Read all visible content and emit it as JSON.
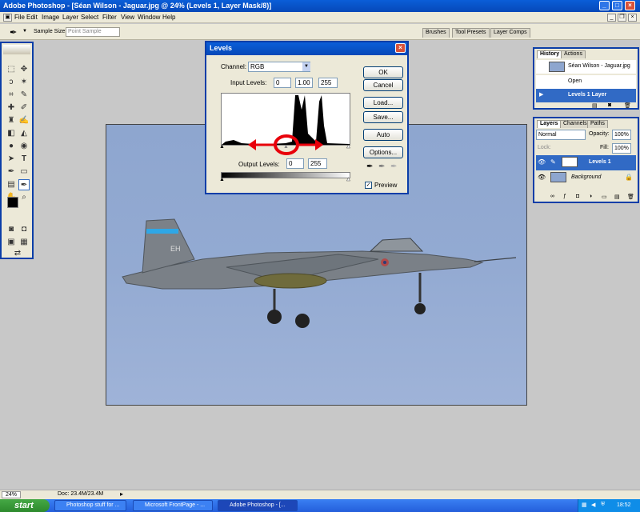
{
  "window": {
    "title": "Adobe Photoshop - [Séan Wilson - Jaguar.jpg @ 24% (Levels 1, Layer Mask/8)]",
    "minimize": "_",
    "maximize": "□",
    "close": "×"
  },
  "menu": [
    "File",
    "Edit",
    "Image",
    "Layer",
    "Select",
    "Filter",
    "View",
    "Window",
    "Help"
  ],
  "options_bar": {
    "sample_size_label": "Sample Size:",
    "sample_size_value": "Point Sample",
    "palette_well_tabs": [
      "Brushes",
      "Tool Presets",
      "Layer Comps"
    ]
  },
  "levels": {
    "title": "Levels",
    "channel_label": "Channel:",
    "channel_value": "RGB",
    "input_levels_label": "Input Levels:",
    "input_black": "0",
    "input_gamma": "1.00",
    "input_white": "255",
    "output_levels_label": "Output Levels:",
    "output_black": "0",
    "output_white": "255",
    "buttons": {
      "ok": "OK",
      "cancel": "Cancel",
      "load": "Load...",
      "save": "Save...",
      "auto": "Auto",
      "options": "Options..."
    },
    "preview_label": "Preview",
    "preview_checked": true
  },
  "history": {
    "tabs": [
      "History",
      "Actions"
    ],
    "snapshot": "Séan Wilson - Jaguar.jpg",
    "steps": [
      "Open",
      "Levels 1 Layer"
    ]
  },
  "layers": {
    "tabs": [
      "Layers",
      "Channels",
      "Paths"
    ],
    "blend_mode": "Normal",
    "opacity_label": "Opacity:",
    "opacity": "100%",
    "lock_label": "Lock:",
    "fill_label": "Fill:",
    "fill": "100%",
    "items": [
      {
        "name": "Levels 1"
      },
      {
        "name": "Background"
      }
    ]
  },
  "status": {
    "zoom": "24%",
    "doc": "Doc: 23.4M/23.4M"
  },
  "taskbar": {
    "start": "start",
    "tasks": [
      "Photoshop stuff for ...",
      "Microsoft FrontPage - ...",
      "Adobe Photoshop - [..."
    ],
    "clock": "18:52"
  },
  "aircraft_marking": "EH",
  "colors": {
    "xp_blue": "#0a5ed8",
    "selection": "#316ac5",
    "annotation_red": "#e8000a",
    "sky": "#8ea6cf"
  }
}
